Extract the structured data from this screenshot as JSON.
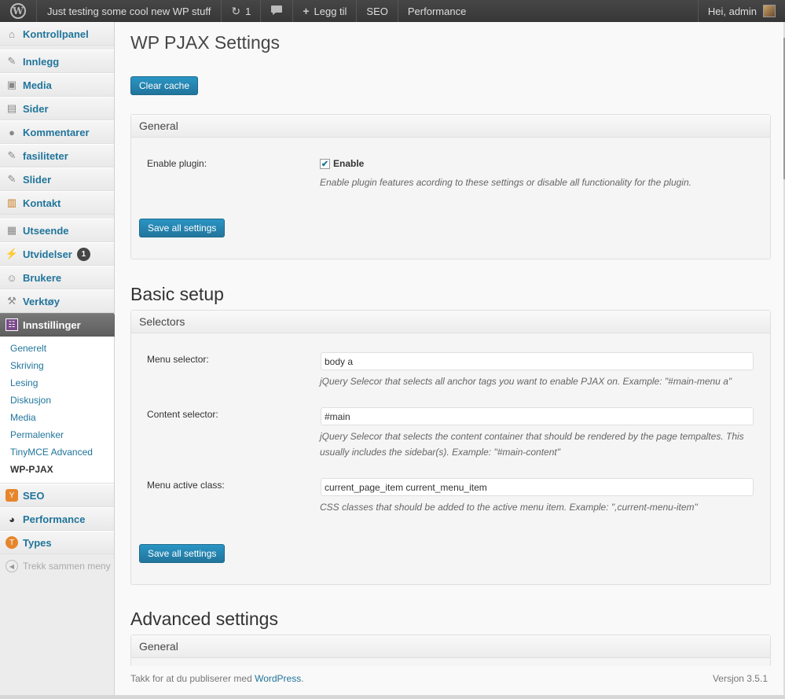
{
  "adminbar": {
    "site_title": "Just testing some cool new WP stuff",
    "updates_count": "1",
    "new_label": "Legg til",
    "seo_label": "SEO",
    "performance_label": "Performance",
    "greeting": "Hei, admin"
  },
  "sidebar": {
    "items": [
      {
        "label": "Kontrollpanel",
        "icon": "dashboard-icon"
      },
      {
        "label": "Innlegg",
        "icon": "pin-icon"
      },
      {
        "label": "Media",
        "icon": "media-icon"
      },
      {
        "label": "Sider",
        "icon": "pages-icon"
      },
      {
        "label": "Kommentarer",
        "icon": "comment-icon"
      },
      {
        "label": "fasiliteter",
        "icon": "pin-icon"
      },
      {
        "label": "Slider",
        "icon": "pin-icon"
      },
      {
        "label": "Kontakt",
        "icon": "contact-icon"
      },
      {
        "label": "Utseende",
        "icon": "appearance-icon"
      },
      {
        "label": "Utvidelser",
        "icon": "plugin-icon",
        "badge": "1"
      },
      {
        "label": "Brukere",
        "icon": "users-icon"
      },
      {
        "label": "Verktøy",
        "icon": "tools-icon"
      },
      {
        "label": "Innstillinger",
        "icon": "settings-icon"
      },
      {
        "label": "SEO",
        "icon": "seo-icon"
      },
      {
        "label": "Performance",
        "icon": "performance-icon"
      },
      {
        "label": "Types",
        "icon": "types-icon"
      }
    ],
    "submenu": [
      "Generelt",
      "Skriving",
      "Lesing",
      "Diskusjon",
      "Media",
      "Permalenker",
      "TinyMCE Advanced",
      "WP-PJAX"
    ],
    "collapse_label": "Trekk sammen meny"
  },
  "main": {
    "title": "WP PJAX Settings",
    "clear_cache_label": "Clear cache",
    "general_box": {
      "title": "General",
      "enable_label": "Enable plugin:",
      "checkbox_label": "Enable",
      "checkbox_checked": true,
      "description": "Enable plugin features acording to these settings or disable all functionality for the plugin.",
      "save_label": "Save all settings"
    },
    "basic_setup": {
      "heading": "Basic setup",
      "box_title": "Selectors",
      "menu_selector_label": "Menu selector:",
      "menu_selector_value": "body a",
      "menu_selector_desc": "jQuery Selecor that selects all anchor tags you want to enable PJAX on. Example: \"#main-menu a\"",
      "content_selector_label": "Content selector:",
      "content_selector_value": "#main",
      "content_selector_desc": "jQuery Selecor that selects the content container that should be rendered by the page tempaltes. This usually includes the sidebar(s). Example: \"#main-content\"",
      "active_class_label": "Menu active class:",
      "active_class_value": "current_page_item current_menu_item",
      "active_class_desc": "CSS classes that should be added to the active menu item. Example: \",current-menu-item\"",
      "save_label": "Save all settings"
    },
    "advanced": {
      "heading": "Advanced settings",
      "box_title": "General"
    }
  },
  "footer": {
    "thanks_prefix": "Takk for at du publiserer med ",
    "wordpress_link": "WordPress",
    "thanks_suffix": ".",
    "version": "Versjon 3.5.1"
  }
}
